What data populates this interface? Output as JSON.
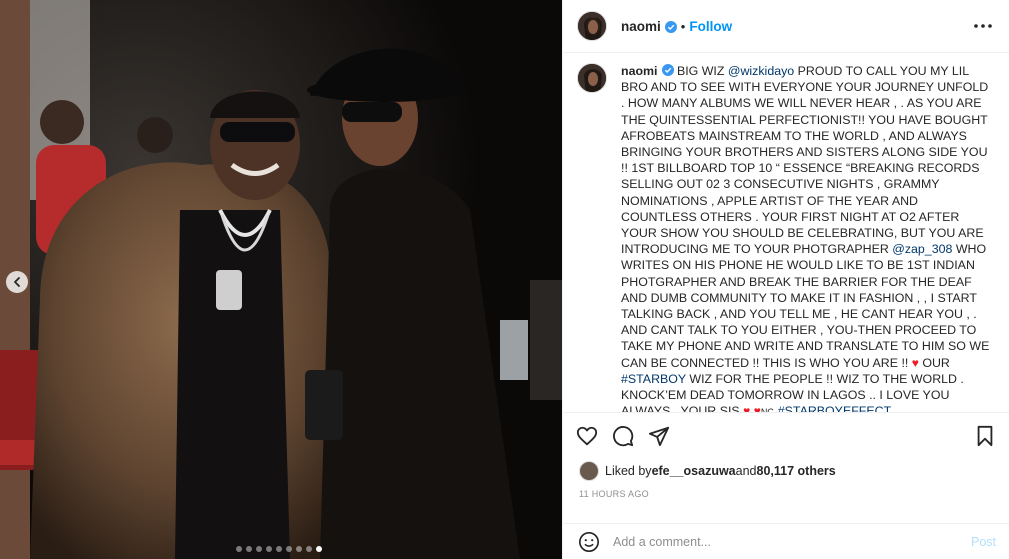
{
  "post": {
    "username": "naomi",
    "follow_label": "Follow",
    "dot": "•",
    "caption": {
      "username": "naomi",
      "part1": " BIG WIZ ",
      "mention1": "@wizkidayo",
      "part2": " PROUD TO CALL YOU MY LIL BRO AND TO SEE WITH EVERYONE YOUR JOURNEY UNFOLD . HOW MANY ALBUMS WE WILL NEVER HEAR , . AS YOU ARE THE QUINTESSENTIAL PERFECTIONIST!! YOU HAVE BOUGHT AFROBEATS MAINSTREAM TO THE WORLD , AND ALWAYS BRINGING YOUR BROTHERS AND SISTERS ALONG SIDE YOU !! 1ST BILLBOARD TOP 10 “ ESSENCE “BREAKING RECORDS SELLING OUT 02 3 CONSECUTIVE NIGHTS , GRAMMY NOMINATIONS , APPLE ARTIST OF THE YEAR AND COUNTLESS OTHERS . YOUR FIRST NIGHT AT O2 AFTER YOUR SHOW YOU SHOULD BE CELEBRATING, BUT YOU ARE INTRODUCING ME TO YOUR PHOTGRAPHER ",
      "mention2": "@zap_308",
      "part3": " WHO WRITES ON HIS PHONE HE WOULD LIKE TO BE 1ST INDIAN PHOTGRAPHER AND BREAK THE BARRIER FOR THE DEAF AND DUMB COMMUNITY TO MAKE IT IN FASHION , , I START TALKING BACK , AND YOU TELL ME , HE CANT HEAR YOU , . AND CANT TALK TO YOU EITHER , YOU-THEN PROCEED TO TAKE MY PHONE AND WRITE AND TRANSLATE TO HIM SO WE CAN BE CONNECTED !! THIS IS WHO YOU ARE !! ",
      "heart_emoji": "♥",
      "part4": " OUR ",
      "hashtag1": "#STARBOY",
      "part5": " WIZ FOR THE PEOPLE !! WIZ TO THE WORLD . KNOCK’EM DEAD TOMORROW IN LAGOS .. I LOVE YOU ALWAYS , YOUR SIS ",
      "flag_text": "NG",
      "hashtag2": "#STARBOYEFFECT"
    },
    "likes": {
      "prefix": "Liked by ",
      "liker": "efe__osazuwa",
      "middle": " and ",
      "count": "80,117 others"
    },
    "time": "11 HOURS AGO",
    "comment": {
      "placeholder": "Add a comment...",
      "post_label": "Post"
    }
  },
  "carousel": {
    "total": 9,
    "active_index": 8
  },
  "icons": {
    "verified": "verified-badge-icon",
    "more": "more-options-icon",
    "like": "heart-icon",
    "comment": "comment-icon",
    "share": "share-icon",
    "save": "bookmark-icon",
    "emoji": "emoji-icon",
    "prev": "chevron-left-icon"
  },
  "colors": {
    "accent": "#0095f6",
    "verified": "#3897f0",
    "link": "#00376b",
    "heart": "#ed1c24"
  }
}
